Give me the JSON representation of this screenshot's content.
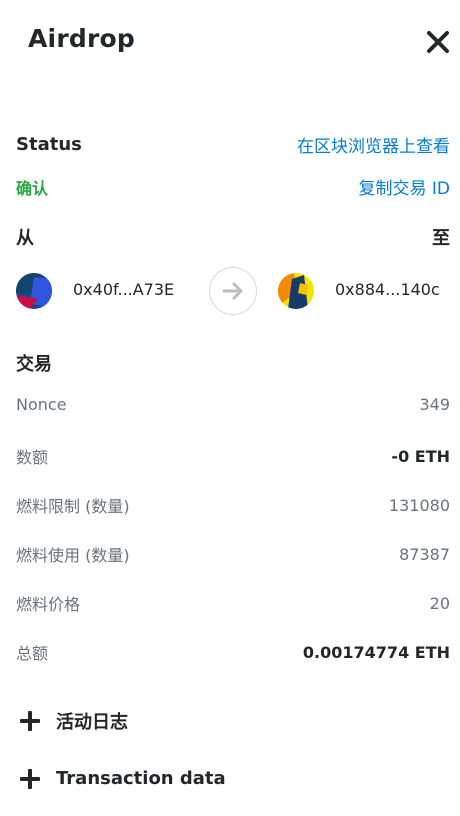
{
  "header": {
    "title": "Airdrop"
  },
  "status": {
    "label": "Status",
    "value": "确认",
    "view_explorer_link": "在区块浏览器上查看",
    "copy_tx_id_link": "复制交易 ID",
    "status_color": "#28a745",
    "link_color": "#037dd6"
  },
  "transfer": {
    "from_label": "从",
    "to_label": "至",
    "from_address": "0x40f...A73E",
    "to_address": "0x884...140c"
  },
  "transaction": {
    "title": "交易",
    "rows": [
      {
        "key": "Nonce",
        "value": "349"
      },
      {
        "key": "数额",
        "value": "-0 ETH"
      },
      {
        "key": "燃料限制 (数量)",
        "value": "131080"
      },
      {
        "key": "燃料使用 (数量)",
        "value": "87387"
      },
      {
        "key": "燃料价格",
        "value": "20"
      },
      {
        "key": "总额",
        "value": "0.00174774 ETH"
      }
    ]
  },
  "expanders": {
    "activity_log": "活动日志",
    "transaction_data": "Transaction data"
  }
}
